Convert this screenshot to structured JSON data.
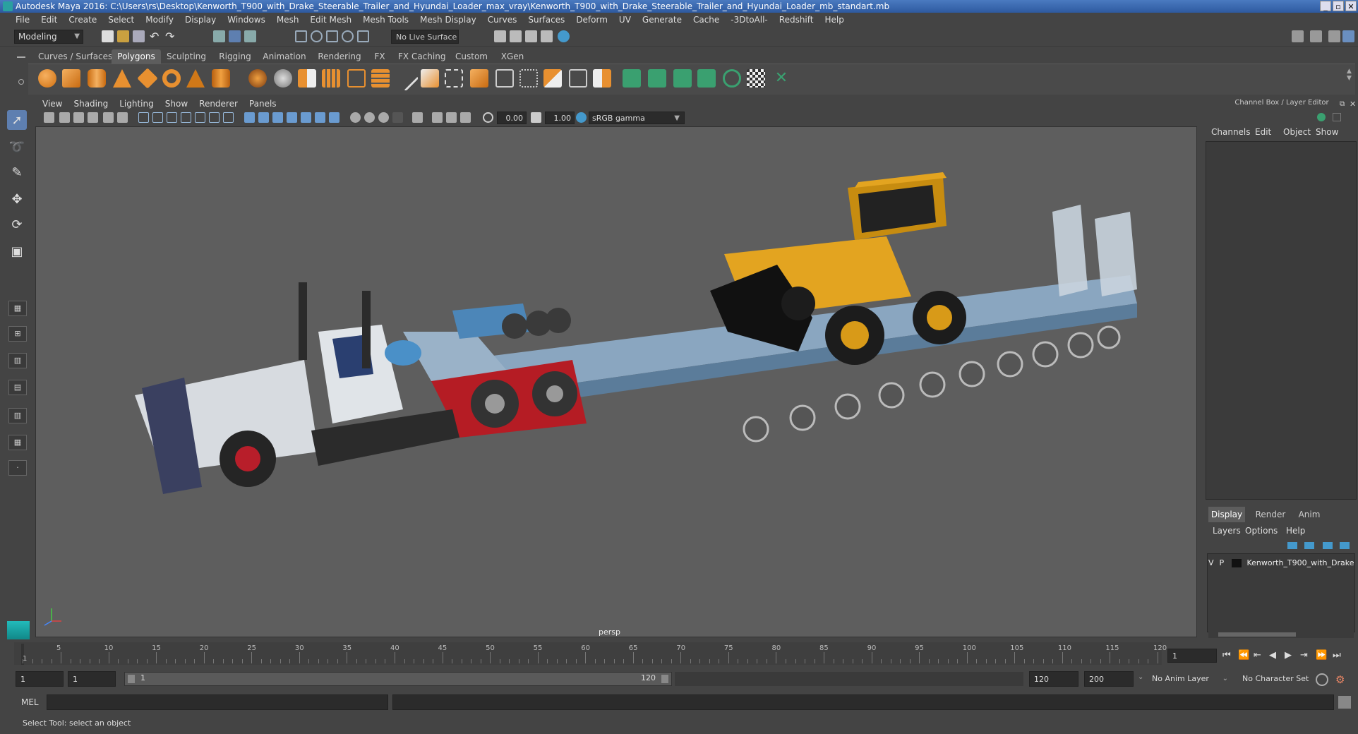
{
  "window": {
    "title": "Autodesk Maya 2016: C:\\Users\\rs\\Desktop\\Kenworth_T900_with_Drake_Steerable_Trailer_and_Hyundai_Loader_max_vray\\Kenworth_T900_with_Drake_Steerable_Trailer_and_Hyundai_Loader_mb_standart.mb"
  },
  "menubar": [
    "File",
    "Edit",
    "Create",
    "Select",
    "Modify",
    "Display",
    "Windows",
    "Mesh",
    "Edit Mesh",
    "Mesh Tools",
    "Mesh Display",
    "Curves",
    "Surfaces",
    "Deform",
    "UV",
    "Generate",
    "Cache",
    "-3DtoAll-",
    "Redshift",
    "Help"
  ],
  "status_line": {
    "mode": "Modeling",
    "live_surface": "No Live Surface"
  },
  "shelf_tabs": [
    "Curves / Surfaces",
    "Polygons",
    "Sculpting",
    "Rigging",
    "Animation",
    "Rendering",
    "FX",
    "FX Caching",
    "Custom",
    "XGen"
  ],
  "shelf_active": "Polygons",
  "viewport": {
    "menus": [
      "View",
      "Shading",
      "Lighting",
      "Show",
      "Renderer",
      "Panels"
    ],
    "exposure": "0.00",
    "gamma": "1.00",
    "color_management": "sRGB gamma",
    "camera_label": "persp"
  },
  "channel_box": {
    "title": "Channel Box / Layer Editor",
    "menus": [
      "Channels",
      "Edit",
      "Object",
      "Show"
    ],
    "display_tabs": [
      "Display",
      "Render",
      "Anim"
    ],
    "active_tab": "Display",
    "layer_menus": [
      "Layers",
      "Options",
      "Help"
    ],
    "layer": {
      "v": "V",
      "p": "P",
      "name": "Kenworth_T900_with_Drake_"
    }
  },
  "time_slider": {
    "ticks": [
      "5",
      "10",
      "15",
      "20",
      "25",
      "30",
      "35",
      "40",
      "45",
      "50",
      "55",
      "60",
      "65",
      "70",
      "75",
      "80",
      "85",
      "90",
      "95",
      "100",
      "105",
      "110",
      "115",
      "120"
    ],
    "start_label": "1",
    "current_frame": "1"
  },
  "range_slider": {
    "start": "1",
    "playback_start": "1",
    "range_inner_start": "1",
    "range_inner_end": "120",
    "playback_end": "120",
    "end": "200",
    "anim_layer": "No Anim Layer",
    "character_set": "No Character Set"
  },
  "command_line": {
    "label": "MEL"
  },
  "status_bar": {
    "message": "Select Tool: select an object"
  },
  "colors": {
    "accent": "#5e7fb0",
    "viewport_bg": "#5e5e5e",
    "title_bar": "#3a68b0"
  }
}
